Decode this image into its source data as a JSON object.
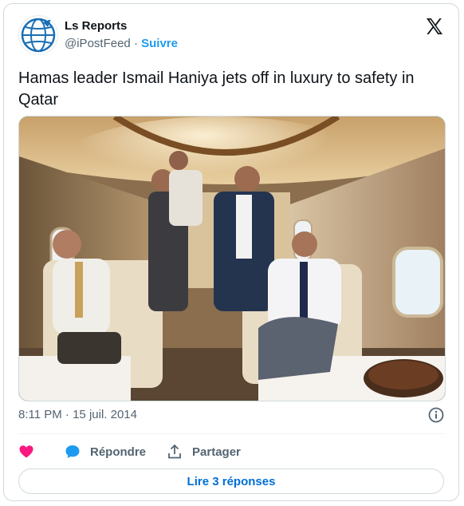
{
  "account": {
    "display_name": "Ls Reports",
    "handle": "@iPostFeed",
    "separator": "·",
    "follow_label": "Suivre"
  },
  "tweet": {
    "text": "Hamas leader Ismail Haniya jets off in luxury to safety in Qatar",
    "time": "8:11 PM",
    "date": "15 juil. 2014"
  },
  "actions": {
    "reply_label": "Répondre",
    "share_label": "Partager",
    "read_replies_label": "Lire 3 réponses"
  },
  "icons": {
    "like": "heart-icon",
    "reply": "speech-bubble-icon",
    "share": "share-arrow-icon",
    "info": "info-icon",
    "brand": "x-logo-icon"
  },
  "colors": {
    "accent": "#1d9bf0",
    "like": "#f91880",
    "link_button_text": "#006fd6",
    "secondary_text": "#536471"
  }
}
